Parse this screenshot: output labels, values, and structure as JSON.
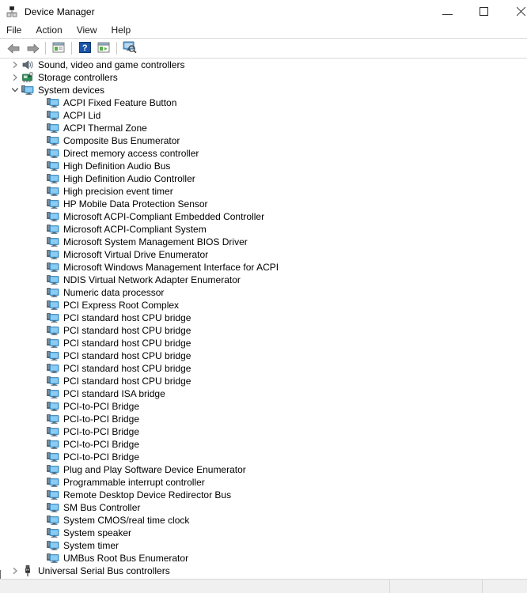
{
  "window": {
    "title": "Device Manager",
    "icon": "device-manager-icon",
    "controls": {
      "minimize": "minimize-button",
      "maximize": "maximize-button",
      "close": "close-button"
    }
  },
  "menubar": {
    "items": [
      {
        "label": "File"
      },
      {
        "label": "Action"
      },
      {
        "label": "View"
      },
      {
        "label": "Help"
      }
    ]
  },
  "toolbar": {
    "buttons": [
      {
        "name": "back-button",
        "icon": "arrow-left-icon"
      },
      {
        "name": "forward-button",
        "icon": "arrow-right-icon"
      },
      {
        "name": "separator-1",
        "icon": "separator"
      },
      {
        "name": "properties-button",
        "icon": "properties-icon"
      },
      {
        "name": "separator-2",
        "icon": "separator"
      },
      {
        "name": "help-button",
        "icon": "question-mark-icon"
      },
      {
        "name": "show-hidden-button",
        "icon": "panel-icon"
      },
      {
        "name": "separator-3",
        "icon": "separator"
      },
      {
        "name": "scan-hardware-button",
        "icon": "monitor-scan-icon"
      }
    ]
  },
  "tree": {
    "nodes": [
      {
        "label": "Sound, video and game controllers",
        "level": 0,
        "expanded": false,
        "has_children": true,
        "icon": "speaker-icon"
      },
      {
        "label": "Storage controllers",
        "level": 0,
        "expanded": false,
        "has_children": true,
        "icon": "storage-card-icon"
      },
      {
        "label": "System devices",
        "level": 0,
        "expanded": true,
        "has_children": true,
        "icon": "system-device-icon"
      },
      {
        "label": "ACPI Fixed Feature Button",
        "level": 1,
        "expanded": false,
        "has_children": false,
        "icon": "system-device-icon"
      },
      {
        "label": "ACPI Lid",
        "level": 1,
        "expanded": false,
        "has_children": false,
        "icon": "system-device-icon"
      },
      {
        "label": "ACPI Thermal Zone",
        "level": 1,
        "expanded": false,
        "has_children": false,
        "icon": "system-device-icon"
      },
      {
        "label": "Composite Bus Enumerator",
        "level": 1,
        "expanded": false,
        "has_children": false,
        "icon": "system-device-icon"
      },
      {
        "label": "Direct memory access controller",
        "level": 1,
        "expanded": false,
        "has_children": false,
        "icon": "system-device-icon"
      },
      {
        "label": "High Definition Audio Bus",
        "level": 1,
        "expanded": false,
        "has_children": false,
        "icon": "system-device-icon"
      },
      {
        "label": "High Definition Audio Controller",
        "level": 1,
        "expanded": false,
        "has_children": false,
        "icon": "system-device-icon"
      },
      {
        "label": "High precision event timer",
        "level": 1,
        "expanded": false,
        "has_children": false,
        "icon": "system-device-icon"
      },
      {
        "label": "HP Mobile Data Protection Sensor",
        "level": 1,
        "expanded": false,
        "has_children": false,
        "icon": "system-device-icon"
      },
      {
        "label": "Microsoft ACPI-Compliant Embedded Controller",
        "level": 1,
        "expanded": false,
        "has_children": false,
        "icon": "system-device-icon"
      },
      {
        "label": "Microsoft ACPI-Compliant System",
        "level": 1,
        "expanded": false,
        "has_children": false,
        "icon": "system-device-icon"
      },
      {
        "label": "Microsoft System Management BIOS Driver",
        "level": 1,
        "expanded": false,
        "has_children": false,
        "icon": "system-device-icon"
      },
      {
        "label": "Microsoft Virtual Drive Enumerator",
        "level": 1,
        "expanded": false,
        "has_children": false,
        "icon": "system-device-icon"
      },
      {
        "label": "Microsoft Windows Management Interface for ACPI",
        "level": 1,
        "expanded": false,
        "has_children": false,
        "icon": "system-device-icon"
      },
      {
        "label": "NDIS Virtual Network Adapter Enumerator",
        "level": 1,
        "expanded": false,
        "has_children": false,
        "icon": "system-device-icon"
      },
      {
        "label": "Numeric data processor",
        "level": 1,
        "expanded": false,
        "has_children": false,
        "icon": "system-device-icon"
      },
      {
        "label": "PCI Express Root Complex",
        "level": 1,
        "expanded": false,
        "has_children": false,
        "icon": "system-device-icon"
      },
      {
        "label": "PCI standard host CPU bridge",
        "level": 1,
        "expanded": false,
        "has_children": false,
        "icon": "system-device-icon"
      },
      {
        "label": "PCI standard host CPU bridge",
        "level": 1,
        "expanded": false,
        "has_children": false,
        "icon": "system-device-icon"
      },
      {
        "label": "PCI standard host CPU bridge",
        "level": 1,
        "expanded": false,
        "has_children": false,
        "icon": "system-device-icon"
      },
      {
        "label": "PCI standard host CPU bridge",
        "level": 1,
        "expanded": false,
        "has_children": false,
        "icon": "system-device-icon"
      },
      {
        "label": "PCI standard host CPU bridge",
        "level": 1,
        "expanded": false,
        "has_children": false,
        "icon": "system-device-icon"
      },
      {
        "label": "PCI standard host CPU bridge",
        "level": 1,
        "expanded": false,
        "has_children": false,
        "icon": "system-device-icon"
      },
      {
        "label": "PCI standard ISA bridge",
        "level": 1,
        "expanded": false,
        "has_children": false,
        "icon": "system-device-icon"
      },
      {
        "label": "PCI-to-PCI Bridge",
        "level": 1,
        "expanded": false,
        "has_children": false,
        "icon": "system-device-icon"
      },
      {
        "label": "PCI-to-PCI Bridge",
        "level": 1,
        "expanded": false,
        "has_children": false,
        "icon": "system-device-icon"
      },
      {
        "label": "PCI-to-PCI Bridge",
        "level": 1,
        "expanded": false,
        "has_children": false,
        "icon": "system-device-icon"
      },
      {
        "label": "PCI-to-PCI Bridge",
        "level": 1,
        "expanded": false,
        "has_children": false,
        "icon": "system-device-icon"
      },
      {
        "label": "PCI-to-PCI Bridge",
        "level": 1,
        "expanded": false,
        "has_children": false,
        "icon": "system-device-icon"
      },
      {
        "label": "Plug and Play Software Device Enumerator",
        "level": 1,
        "expanded": false,
        "has_children": false,
        "icon": "system-device-icon"
      },
      {
        "label": "Programmable interrupt controller",
        "level": 1,
        "expanded": false,
        "has_children": false,
        "icon": "system-device-icon"
      },
      {
        "label": "Remote Desktop Device Redirector Bus",
        "level": 1,
        "expanded": false,
        "has_children": false,
        "icon": "system-device-icon"
      },
      {
        "label": "SM Bus Controller",
        "level": 1,
        "expanded": false,
        "has_children": false,
        "icon": "system-device-icon"
      },
      {
        "label": "System CMOS/real time clock",
        "level": 1,
        "expanded": false,
        "has_children": false,
        "icon": "system-device-icon"
      },
      {
        "label": "System speaker",
        "level": 1,
        "expanded": false,
        "has_children": false,
        "icon": "system-device-icon"
      },
      {
        "label": "System timer",
        "level": 1,
        "expanded": false,
        "has_children": false,
        "icon": "system-device-icon"
      },
      {
        "label": "UMBus Root Bus Enumerator",
        "level": 1,
        "expanded": false,
        "has_children": false,
        "icon": "system-device-icon"
      },
      {
        "label": "Universal Serial Bus controllers",
        "level": 0,
        "expanded": false,
        "has_children": true,
        "icon": "usb-plug-icon"
      }
    ]
  },
  "statusbar": {
    "panes": [
      "",
      "",
      ""
    ]
  },
  "colors": {
    "device_icon_blue": "#4aa3df",
    "device_icon_dark": "#3b4a5a",
    "window_bg": "#ffffff",
    "statusbar_bg": "#f0f0f0",
    "border": "#d8d8d8"
  }
}
